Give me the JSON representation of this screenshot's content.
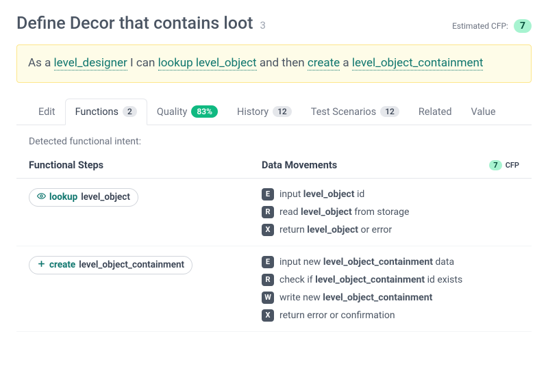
{
  "header": {
    "title": "Define Decor that contains loot",
    "title_num": "3",
    "est_label": "Estimated CFP:",
    "est_value": "7"
  },
  "story": {
    "prefix1": "As a ",
    "actor": "level_designer",
    "mid1": " I can ",
    "action1": "lookup level_object",
    "mid2": " and then ",
    "action2": "create",
    "mid3": " a ",
    "action3": "level_object_containment"
  },
  "tabs": {
    "edit": "Edit",
    "functions": "Functions",
    "functions_count": "2",
    "quality": "Quality",
    "quality_pct": "83%",
    "history": "History",
    "history_count": "12",
    "tests": "Test Scenarios",
    "tests_count": "12",
    "related": "Related",
    "value": "Value"
  },
  "detected": "Detected functional intent:",
  "table_head": {
    "steps": "Functional Steps",
    "movements": "Data Movements",
    "cfp_value": "7",
    "cfp_label": "CFP"
  },
  "rows": [
    {
      "verb": "lookup",
      "obj": "level_object",
      "icon": "eye",
      "movements": [
        {
          "tag": "E",
          "pre": "input ",
          "bold": "level_object",
          "post": " id"
        },
        {
          "tag": "R",
          "pre": "read ",
          "bold": "level_object",
          "post": " from storage"
        },
        {
          "tag": "X",
          "pre": "return ",
          "bold": "level_object",
          "post": " or error"
        }
      ]
    },
    {
      "verb": "create",
      "obj": "level_object_containment",
      "icon": "plus",
      "movements": [
        {
          "tag": "E",
          "pre": "input new ",
          "bold": "level_object_containment",
          "post": " data"
        },
        {
          "tag": "R",
          "pre": "check if ",
          "bold": "level_object_containment",
          "post": " id exists"
        },
        {
          "tag": "W",
          "pre": "write new ",
          "bold": "level_object_containment",
          "post": ""
        },
        {
          "tag": "X",
          "pre": "return error or confirmation",
          "bold": "",
          "post": ""
        }
      ]
    }
  ]
}
